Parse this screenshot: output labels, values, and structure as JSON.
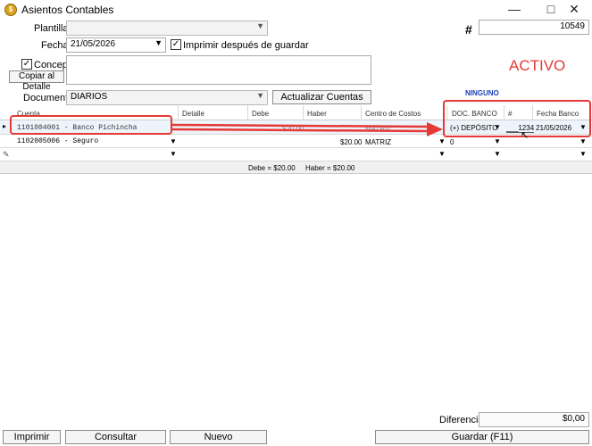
{
  "window": {
    "title": "Asientos Contables",
    "icon": "app-logo-icon"
  },
  "header": {
    "plantilla_label": "Plantilla",
    "plantilla_value": "",
    "hash_label": "#",
    "number_value": "10549",
    "fecha_label": "Fecha",
    "fecha_value": "21/05/2026",
    "imprimir_label": "Imprimir después de guardar",
    "concepto_label": "Concepto",
    "copiar_label": "Copiar al Detalle",
    "status_text": "ACTIVO",
    "documento_label": "Documento",
    "documento_value": "DIARIOS",
    "actualizar_label": "Actualizar Cuentas",
    "ninguno_text": "NINGUNO"
  },
  "grid": {
    "columns": [
      "Cuenta",
      "Detalle",
      "Debe",
      "Haber",
      "Centro de Costos",
      "DOC. BANCO",
      "#",
      "Fecha Banco"
    ],
    "rows": [
      {
        "cuenta": "1101004001 - Banco Pichincha",
        "detalle": "",
        "debe": "$20.00",
        "haber": "",
        "centro": "MATRIZ",
        "doc_banco": "(+) DEPÓSITO",
        "num": "___1234",
        "fecha_banco": "21/05/2026"
      },
      {
        "cuenta": "1102005006 - Seguro",
        "detalle": "",
        "debe": "",
        "haber": "$20.00",
        "centro": "MATRIZ",
        "doc_banco": "0",
        "num": "",
        "fecha_banco": ""
      }
    ],
    "totals": {
      "debe": "Debe = $20.00",
      "haber": "Haber = $20.00"
    }
  },
  "footer": {
    "diferencia_label": "Diferencia:",
    "diferencia_value": "$0,00",
    "imprimir_btn": "Imprimir",
    "consultar_btn": "Consultar",
    "nuevo_btn": "Nuevo",
    "guardar_btn": "Guardar (F11)"
  },
  "colors": {
    "status_red": "#e53935",
    "ninguno_blue": "#1a3fb5",
    "annotation_red": "#e53935"
  }
}
